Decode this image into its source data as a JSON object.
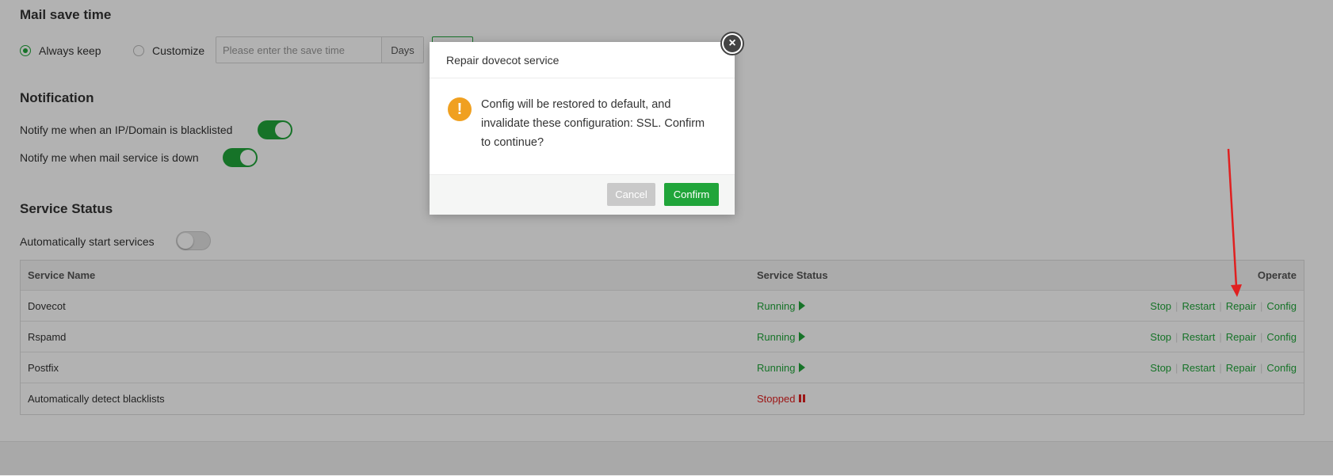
{
  "mail_save": {
    "title": "Mail save time",
    "option_always": "Always keep",
    "option_customize": "Customize",
    "input_placeholder": "Please enter the save time",
    "unit": "Days"
  },
  "notification": {
    "title": "Notification",
    "blacklist_label": "Notify me when an IP/Domain is blacklisted",
    "blacklist_on": true,
    "service_down_label": "Notify me when mail service is down",
    "service_down_on": true
  },
  "service_status": {
    "title": "Service Status",
    "auto_start_label": "Automatically start services",
    "auto_start_on": false,
    "columns": [
      "Service Name",
      "Service Status",
      "Operate"
    ],
    "rows": [
      {
        "name": "Dovecot",
        "status": "Running",
        "ops": [
          "Stop",
          "Restart",
          "Repair",
          "Config"
        ]
      },
      {
        "name": "Rspamd",
        "status": "Running",
        "ops": [
          "Stop",
          "Restart",
          "Repair",
          "Config"
        ]
      },
      {
        "name": "Postfix",
        "status": "Running",
        "ops": [
          "Stop",
          "Restart",
          "Repair",
          "Config"
        ]
      },
      {
        "name": "Automatically detect blacklists",
        "status": "Stopped",
        "ops": []
      }
    ]
  },
  "dialog": {
    "title": "Repair dovecot service",
    "message": "Config will be restored to default, and invalidate these configuration: SSL. Confirm to continue?",
    "cancel": "Cancel",
    "confirm": "Confirm",
    "close_icon": "close-icon",
    "warning_icon": "warning-icon"
  },
  "colors": {
    "accent": "#20a53a",
    "danger": "#e02020",
    "warning": "#f0a020",
    "annotation": "#e02020"
  }
}
